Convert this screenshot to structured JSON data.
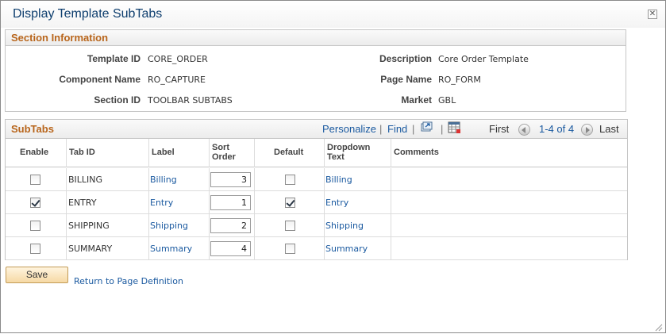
{
  "window": {
    "title": "Display Template SubTabs"
  },
  "section_info": {
    "header": "Section Information",
    "fields": {
      "template_id": {
        "label": "Template ID",
        "value": "CORE_ORDER"
      },
      "component_name": {
        "label": "Component Name",
        "value": "RO_CAPTURE"
      },
      "section_id": {
        "label": "Section ID",
        "value": "TOOLBAR SUBTABS"
      },
      "description": {
        "label": "Description",
        "value": "Core Order Template"
      },
      "page_name": {
        "label": "Page Name",
        "value": "RO_FORM"
      },
      "market": {
        "label": "Market",
        "value": "GBL"
      }
    }
  },
  "subtabs": {
    "title": "SubTabs",
    "toolbar": {
      "personalize": "Personalize",
      "find": "Find",
      "separator": "|",
      "first": "First",
      "range": "1-4 of 4",
      "last": "Last"
    },
    "columns": {
      "enable": "Enable",
      "tab_id": "Tab ID",
      "label": "Label",
      "sort_order_1": "Sort",
      "sort_order_2": "Order",
      "default": "Default",
      "dropdown_1": "Dropdown",
      "dropdown_2": "Text",
      "comments": "Comments"
    },
    "rows": [
      {
        "enable": false,
        "tab_id": "BILLING",
        "label": "Billing",
        "sort_order": "3",
        "default": false,
        "dropdown_text": "Billing"
      },
      {
        "enable": true,
        "tab_id": "ENTRY",
        "label": "Entry",
        "sort_order": "1",
        "default": true,
        "dropdown_text": "Entry"
      },
      {
        "enable": false,
        "tab_id": "SHIPPING",
        "label": "Shipping",
        "sort_order": "2",
        "default": false,
        "dropdown_text": "Shipping"
      },
      {
        "enable": false,
        "tab_id": "SUMMARY",
        "label": "Summary",
        "sort_order": "4",
        "default": false,
        "dropdown_text": "Summary"
      }
    ]
  },
  "footer": {
    "save_label": "Save",
    "return_link": "Return to Page Definition"
  },
  "icons": {
    "close": "close-icon",
    "view_all": "view-all-icon",
    "download": "spreadsheet-download-icon",
    "prev": "previous-arrow-icon",
    "next": "next-arrow-icon"
  },
  "colors": {
    "title_text": "#0f3f6f",
    "section_header_text": "#b8651b",
    "link": "#1b5aa0",
    "save_button": "#f6d9a4"
  }
}
